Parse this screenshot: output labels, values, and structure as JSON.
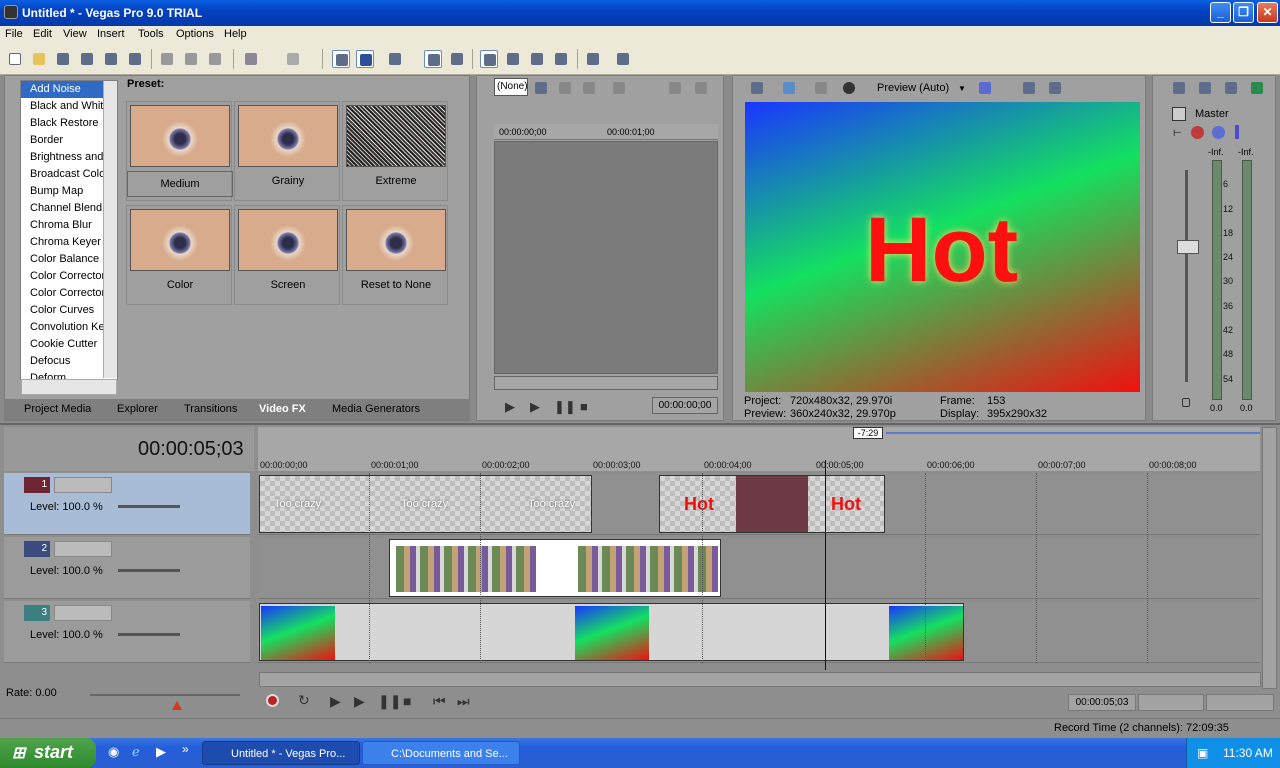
{
  "window": {
    "title": "Untitled * - Vegas Pro 9.0 TRIAL",
    "minimize": "_",
    "maximize": "❐",
    "close": "✕"
  },
  "menu": [
    "File",
    "Edit",
    "View",
    "Insert",
    "Tools",
    "Options",
    "Help"
  ],
  "fx_panel": {
    "effects": [
      "Add Noise",
      "Black and White",
      "Black Restore",
      "Border",
      "Brightness and Contrast",
      "Broadcast Colors",
      "Bump Map",
      "Channel Blend",
      "Chroma Blur",
      "Chroma Keyer",
      "Color Balance",
      "Color Corrector",
      "Color Corrector (Secondary)",
      "Color Curves",
      "Convolution Kernel",
      "Cookie Cutter",
      "Defocus",
      "Deform"
    ],
    "preset_label": "Preset:",
    "presets": [
      "Medium",
      "Grainy",
      "Extreme",
      "Color",
      "Screen",
      "Reset to None"
    ],
    "tabs": [
      "Project Media",
      "Explorer",
      "Transitions",
      "Video FX",
      "Media Generators"
    ],
    "active_tab": "Video FX"
  },
  "trimmer": {
    "dropdown": "(None)",
    "ruler": [
      "00:00:00;00",
      "00:00:01;00"
    ],
    "time": "00:00:00;00"
  },
  "preview": {
    "mode": "Preview (Auto)",
    "overlay_text": "Hot",
    "project_label": "Project:",
    "project_value": "720x480x32, 29.970i",
    "preview_label": "Preview:",
    "preview_value": "360x240x32, 29.970p",
    "frame_label": "Frame:",
    "frame_value": "153",
    "display_label": "Display:",
    "display_value": "395x290x32"
  },
  "mixer": {
    "master_label": "Master",
    "peak_left": "-Inf.",
    "peak_right": "-Inf.",
    "scale": [
      "6",
      "12",
      "18",
      "24",
      "30",
      "36",
      "42",
      "48",
      "54"
    ],
    "value_left": "0.0",
    "value_right": "0.0"
  },
  "timeline": {
    "current_time": "00:00:05;03",
    "cursor_marker": "-7:29",
    "ruler": [
      "00:00:00;00",
      "00:00:01;00",
      "00:00:02;00",
      "00:00:03;00",
      "00:00:04;00",
      "00:00:05;00",
      "00:00:06;00",
      "00:00:07;00",
      "00:00:08;00"
    ],
    "tracks": [
      {
        "number": "1",
        "level": "Level: 100.0 %",
        "color": "#6e2433"
      },
      {
        "number": "2",
        "level": "Level: 100.0 %",
        "color": "#3a4c7d"
      },
      {
        "number": "3",
        "level": "Level: 100.0 %",
        "color": "#3b7f82"
      }
    ],
    "clip_texts": {
      "too_crazy": "Too crazy",
      "hot": "Hot"
    },
    "rate": "Rate: 0.00",
    "transport_time": "00:00:05;03",
    "record_time": "Record Time (2 channels): 72:09:35"
  },
  "taskbar": {
    "start": "start",
    "items": [
      "Untitled * - Vegas Pro...",
      "C:\\Documents and Se..."
    ],
    "clock": "11:30 AM",
    "chevron": "»"
  }
}
